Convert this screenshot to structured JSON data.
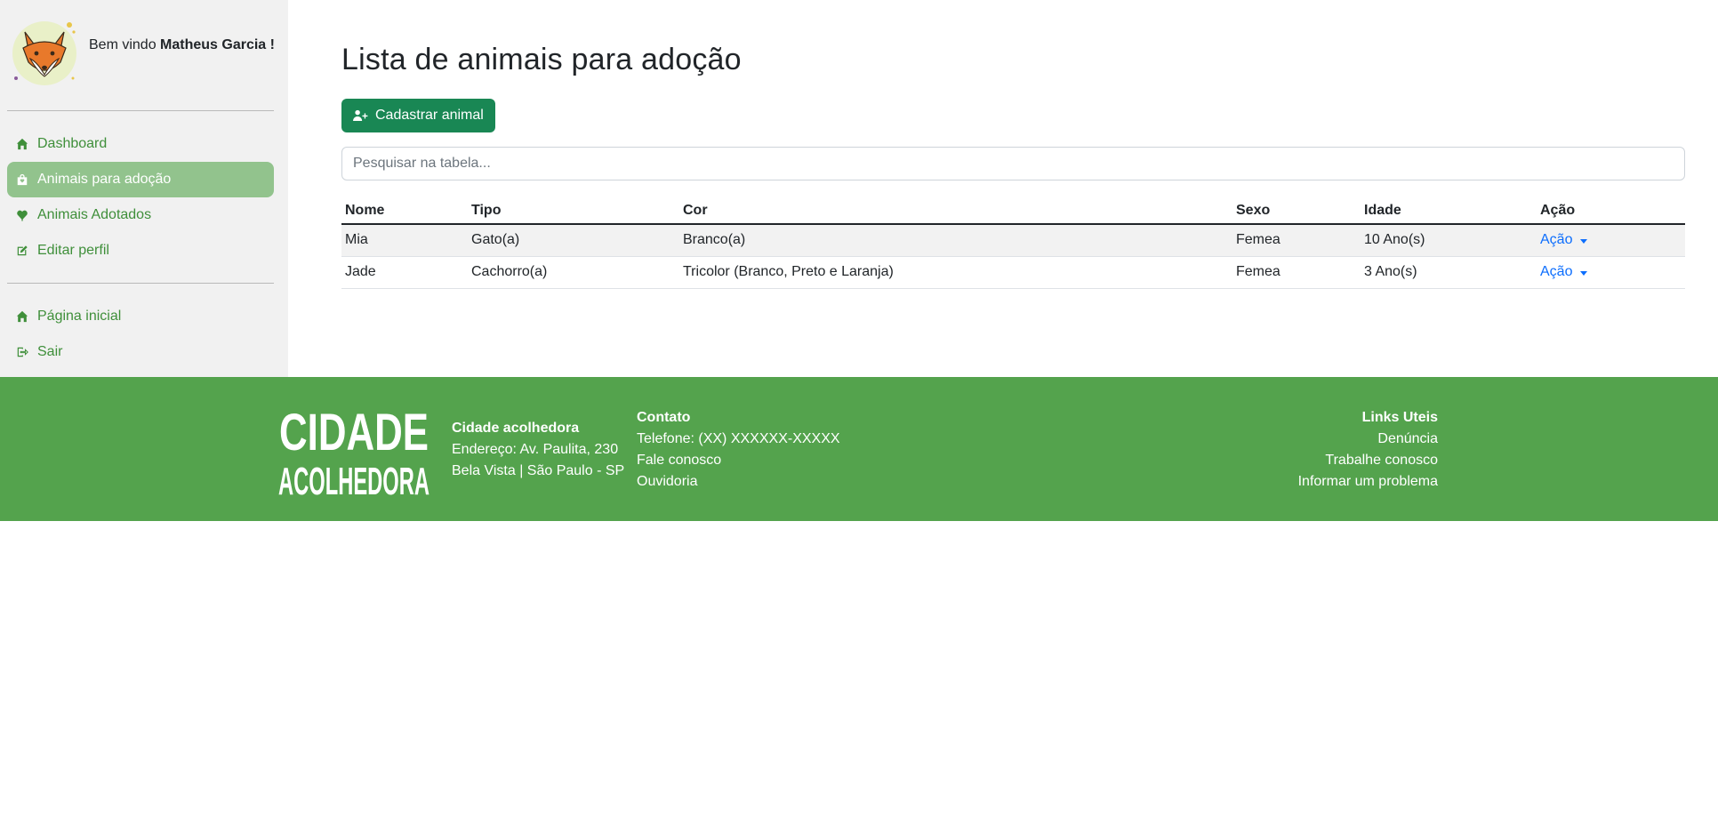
{
  "sidebar": {
    "welcome_prefix": "Bem vindo",
    "user_name": "Matheus Garcia !",
    "items": [
      {
        "label": "Dashboard",
        "icon": "home-icon"
      },
      {
        "label": "Animais para adoção",
        "icon": "bag-icon",
        "active": true
      },
      {
        "label": "Animais Adotados",
        "icon": "heart-icon"
      },
      {
        "label": "Editar perfil",
        "icon": "edit-icon"
      }
    ],
    "bottom_items": [
      {
        "label": "Página inicial",
        "icon": "home-icon"
      },
      {
        "label": "Sair",
        "icon": "logout-icon"
      }
    ]
  },
  "main": {
    "title": "Lista de animais para adoção",
    "add_button": "Cadastrar animal",
    "search_placeholder": "Pesquisar na tabela...",
    "table": {
      "headers": [
        "Nome",
        "Tipo",
        "Cor",
        "Sexo",
        "Idade",
        "Ação"
      ],
      "rows": [
        {
          "nome": "Mia",
          "tipo": "Gato(a)",
          "cor": "Branco(a)",
          "sexo": "Femea",
          "idade": "10 Ano(s)",
          "acao": "Ação"
        },
        {
          "nome": "Jade",
          "tipo": "Cachorro(a)",
          "cor": "Tricolor (Branco, Preto e Laranja)",
          "sexo": "Femea",
          "idade": "3 Ano(s)",
          "acao": "Ação"
        }
      ]
    }
  },
  "footer": {
    "logo_text": [
      "CIDADE",
      "ACOLHEDORA"
    ],
    "org": {
      "name": "Cidade acolhedora",
      "address": "Endereço: Av. Paulita, 230",
      "city": "Bela Vista | São Paulo - SP"
    },
    "contact": {
      "title": "Contato",
      "phone": "Telefone: (XX) XXXXXX-XXXXX",
      "links": [
        "Fale conosco",
        "Ouvidoria"
      ]
    },
    "useful_links": {
      "title": "Links Uteis",
      "links": [
        "Denúncia",
        "Trabalhe conosco",
        "Informar um problema"
      ]
    }
  },
  "colors": {
    "brand_green": "#54a34d",
    "button_green": "#198754",
    "active_nav": "#92c38d",
    "nav_text": "#3f8f3a",
    "link_blue": "#0d6efd"
  }
}
